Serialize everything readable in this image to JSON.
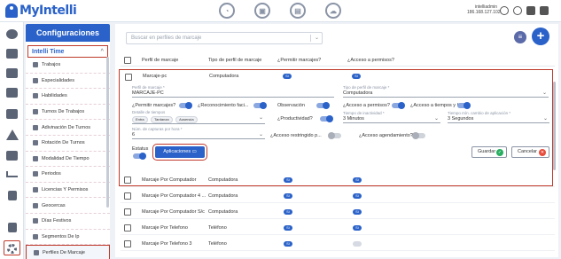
{
  "app": {
    "logo_text": "MyIntelli"
  },
  "header": {
    "icons": [
      "speedometer-icon",
      "briefcase-person-icon",
      "briefcase-lock-icon",
      "cloud-upload-icon"
    ],
    "user_name": "intelliadmin",
    "user_ip": "186.168.127.102"
  },
  "rail": {
    "icons": [
      "dashboard-icon",
      "users-icon",
      "id-card-icon",
      "calendar-icon",
      "alert-icon",
      "document-icon",
      "chart-icon",
      "report-icon",
      "file-icon",
      "settings-icon"
    ]
  },
  "sidemenu": {
    "title": "Configuraciones",
    "section": "Intelli Time",
    "items": [
      "Trabajos",
      "Especialidades",
      "Habilidades",
      "Turnos De Trabajos",
      "Adivinación De Turnos",
      "Rotación De Turnos",
      "Modalidad De Tiempo",
      "Periodos",
      "Licencias Y Permisos",
      "Geocercas",
      "Días Festivos",
      "Segmentos De Ip",
      "Perfiles De Marcaje"
    ],
    "active_item": "Perfiles De Marcaje"
  },
  "search": {
    "placeholder": "Buscar en perfiles de marcaje"
  },
  "table": {
    "headers": [
      "Perfil de marcaje",
      "Tipo de perfil de marcaje",
      "¿Permitir marcajes?",
      "¿Acceso a permisos?"
    ],
    "rows": [
      {
        "name": "Marcaje Por Computador",
        "type": "Computadora",
        "permitir": "Sí",
        "permisos": "Sí"
      },
      {
        "name": "Marcaje Por Computador 4 ...",
        "type": "Computadora",
        "permitir": "Sí",
        "permisos": "Sí"
      },
      {
        "name": "Marcaje Por Computador S/c",
        "type": "Computadora",
        "permitir": "Sí",
        "permisos": "Sí"
      },
      {
        "name": "Marcaje Por Telefono",
        "type": "Teléfono",
        "permitir": "Sí",
        "permisos": "Sí"
      },
      {
        "name": "Marcaje Por Telefono 3",
        "type": "Teléfono",
        "permitir": "Sí",
        "permisos": "No"
      }
    ]
  },
  "edit": {
    "row_name": "Marcaje-pc",
    "row_type": "Computadora",
    "perfil_label": "Perfil de marcaje *",
    "perfil_value": "MARCAJE-PC",
    "tipo_label": "Tipo de perfil de marcaje *",
    "tipo_value": "Computadora",
    "permitir_label": "¿Permitir marcajes?",
    "reconocimiento_label": "¿Reconocimiento faci...",
    "observacion_label": "Observación",
    "acceso_permisos_label": "¿Acceso a permisos?",
    "acceso_tiempos_label": "¿Acceso a tiempos y h...",
    "detalle_label": "Detalle de tiempos",
    "detalle_chips": [
      "Entra",
      "Tardanza",
      "Ausencia"
    ],
    "productividad_label": "¿Productividad?",
    "inactividad_label": "Tiempo de inactividad *",
    "inactividad_value": "3 Minutos",
    "cambio_label": "Tiempo mín. cambio de aplicación *",
    "cambio_value": "3 Segundos",
    "capturas_label": "Núm. de capturas por hora *",
    "capturas_value": "6",
    "restringido_label": "¿Acceso restringido p...",
    "agendamiento_label": "¿Acceso agendamiento?",
    "estatus_label": "Estatus",
    "aplicaciones_label": "Aplicaciones",
    "guardar_label": "Guardar",
    "cancelar_label": "Cancelar"
  },
  "colors": {
    "accent": "#2a62c9",
    "highlight": "#c0392b"
  }
}
